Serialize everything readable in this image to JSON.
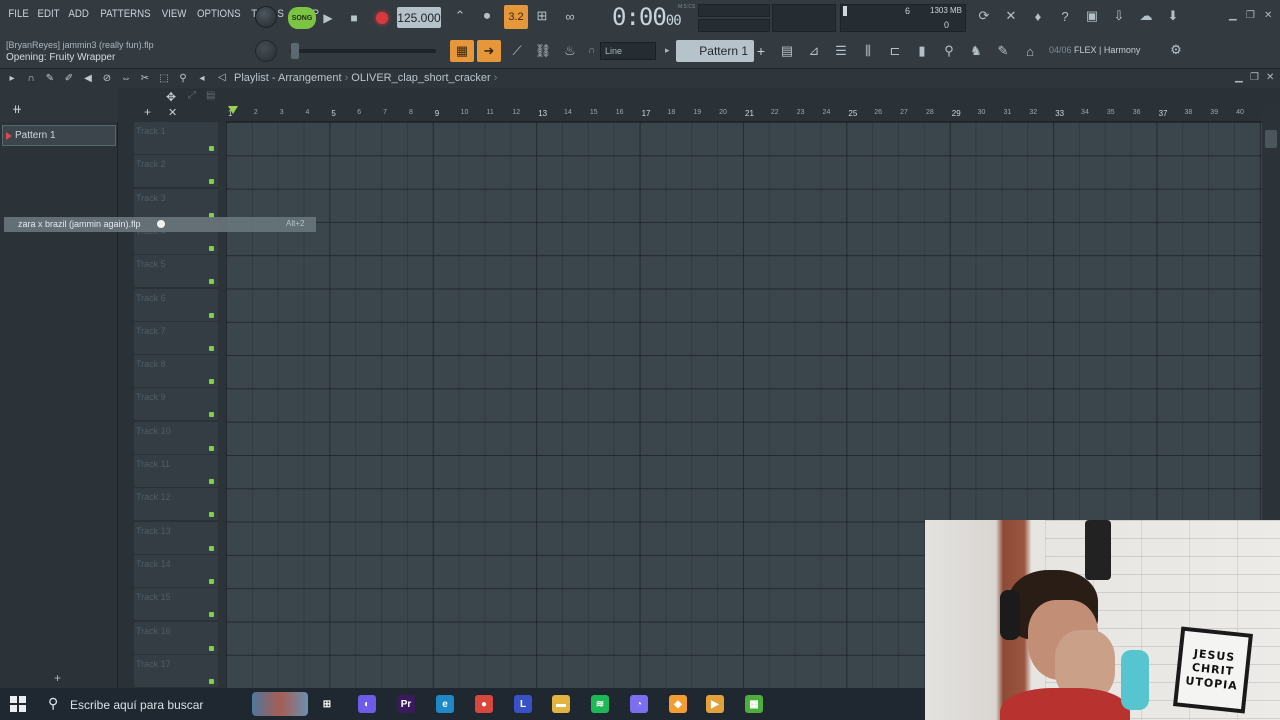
{
  "menu": [
    "FILE",
    "EDIT",
    "ADD",
    "PATTERNS",
    "VIEW",
    "OPTIONS",
    "TOOLS",
    "HELP"
  ],
  "transport": {
    "mode_label": "SONG",
    "tempo": "125.000",
    "time_main": "0:00",
    "time_sub": "00",
    "time_unit": "M:S:CS",
    "step_label": "3.2"
  },
  "monitor": {
    "cpu": "6",
    "memory": "1303 MB",
    "polyphony": "0"
  },
  "hint": {
    "user": "[BryanReyes]",
    "project": "jammin3 (really fun).flp",
    "status": "Opening: Fruity Wrapper"
  },
  "toolbar": {
    "snap": "Line",
    "pattern": "Pattern 1",
    "news_date": "04/06",
    "news_text": "FLEX | Harmony"
  },
  "playlist": {
    "title": "Playlist - Arrangement",
    "separator": "›",
    "clip": "OLIVER_clap_short_cracker",
    "trail": "›"
  },
  "picker": {
    "pattern_item": "Pattern 1"
  },
  "tracks": [
    "Track 1",
    "Track 2",
    "Track 3",
    "Track 4",
    "Track 5",
    "Track 6",
    "Track 7",
    "Track 8",
    "Track 9",
    "Track 10",
    "Track 11",
    "Track 12",
    "Track 13",
    "Track 14",
    "Track 15",
    "Track 16",
    "Track 17"
  ],
  "ruler": [
    "1",
    "2",
    "3",
    "4",
    "5",
    "6",
    "7",
    "8",
    "9",
    "10",
    "11",
    "12",
    "13",
    "14",
    "15",
    "16",
    "17",
    "18",
    "19",
    "20",
    "21",
    "22",
    "23",
    "24",
    "25",
    "26",
    "27",
    "28",
    "29",
    "30",
    "31",
    "32",
    "33",
    "34",
    "35",
    "36",
    "37",
    "38",
    "39",
    "40"
  ],
  "recent_tip": {
    "file": "zara x brazil (jammin again).flp",
    "shortcut": "Alt+2"
  },
  "webcam": {
    "sign": [
      "JESUS",
      "CHRIT",
      "UTOPIA"
    ]
  },
  "taskbar": {
    "search_placeholder": "Escribe aquí para buscar",
    "apps": [
      {
        "name": "task-view",
        "glyph": "⊞",
        "color": "#1f2730"
      },
      {
        "name": "copilot",
        "glyph": "◐",
        "color": "#6c5ce7"
      },
      {
        "name": "premiere",
        "glyph": "Pr",
        "color": "#3a1a5c"
      },
      {
        "name": "edge",
        "glyph": "e",
        "color": "#1e88c9"
      },
      {
        "name": "chrome",
        "glyph": "●",
        "color": "#d9463b"
      },
      {
        "name": "launcher-l",
        "glyph": "L",
        "color": "#3951c6"
      },
      {
        "name": "file-explorer",
        "glyph": "▬",
        "color": "#e3b341"
      },
      {
        "name": "spotify",
        "glyph": "≋",
        "color": "#1db954"
      },
      {
        "name": "discord",
        "glyph": "◔",
        "color": "#7b6ff0"
      },
      {
        "name": "fl-studio",
        "glyph": "◆",
        "color": "#f39c32"
      },
      {
        "name": "media",
        "glyph": "▶",
        "color": "#e2a13b"
      },
      {
        "name": "minecraft",
        "glyph": "▦",
        "color": "#4caf3c"
      }
    ]
  },
  "colors": {
    "accent_green": "#7bc542",
    "accent_orange": "#e6973a",
    "record_red": "#d9383f"
  }
}
